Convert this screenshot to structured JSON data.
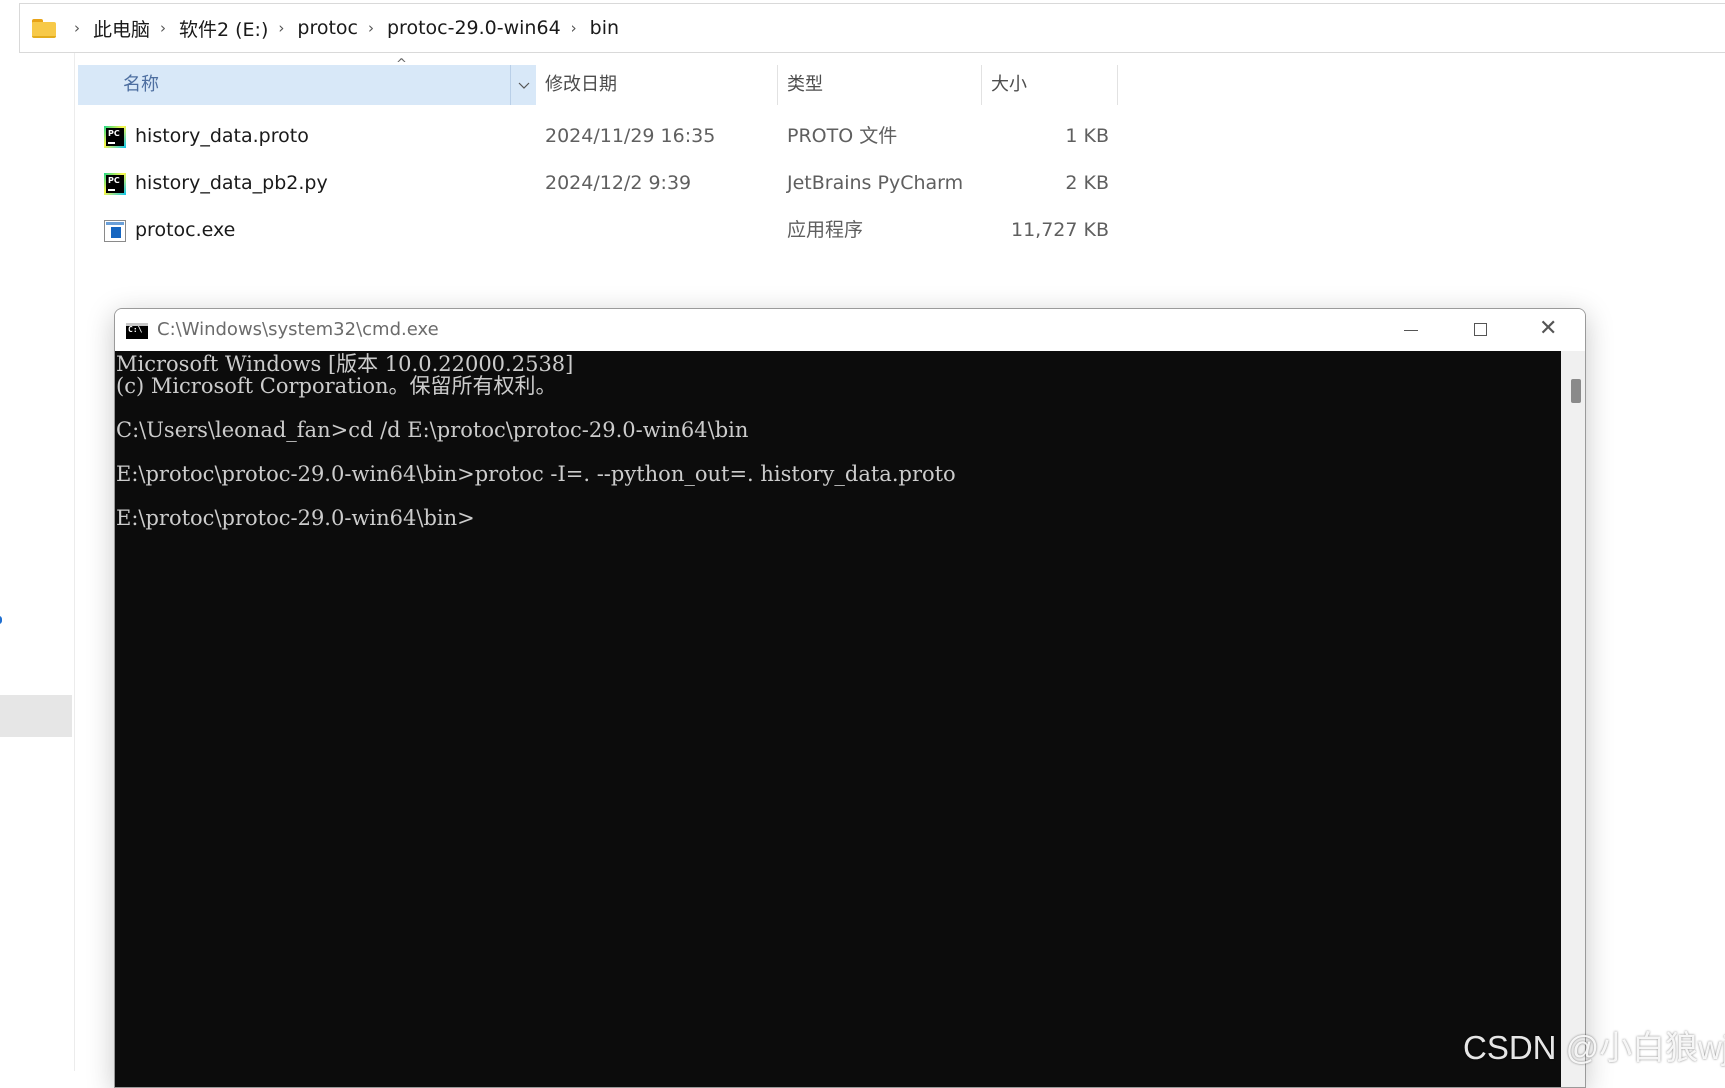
{
  "breadcrumb": {
    "items": [
      "此电脑",
      "软件2 (E:)",
      "protoc",
      "protoc-29.0-win64",
      "bin"
    ],
    "separator": "›"
  },
  "columns": {
    "name": "名称",
    "date": "修改日期",
    "type": "类型",
    "size": "大小"
  },
  "files": [
    {
      "name": "history_data.proto",
      "date": "2024/11/29 16:35",
      "type": "PROTO 文件",
      "size": "1 KB",
      "icon": "pycharm-file-icon"
    },
    {
      "name": "history_data_pb2.py",
      "date": "2024/12/2 9:39",
      "type": "JetBrains PyCharm",
      "size": "2 KB",
      "icon": "pycharm-file-icon"
    },
    {
      "name": "protoc.exe",
      "date": "",
      "type": "应用程序",
      "size": "11,727 KB",
      "icon": "exe-app-icon"
    }
  ],
  "cmd": {
    "title": "C:\\Windows\\system32\\cmd.exe",
    "lines": [
      "Microsoft Windows [版本 10.0.22000.2538]",
      "(c) Microsoft Corporation。保留所有权利。",
      "",
      "C:\\Users\\leonad_fan>cd /d E:\\protoc\\protoc-29.0-win64\\bin",
      "",
      "E:\\protoc\\protoc-29.0-win64\\bin>protoc -I=. --python_out=. history_data.proto",
      "",
      "E:\\protoc\\protoc-29.0-win64\\bin>"
    ],
    "close_glyph": "✕"
  },
  "watermark": "CSDN @小白狼wjj",
  "colors": {
    "header_selected_bg": "#d8e8f8",
    "console_bg": "#0c0c0c",
    "console_text": "#cccccc",
    "folder": "#f7c948"
  }
}
